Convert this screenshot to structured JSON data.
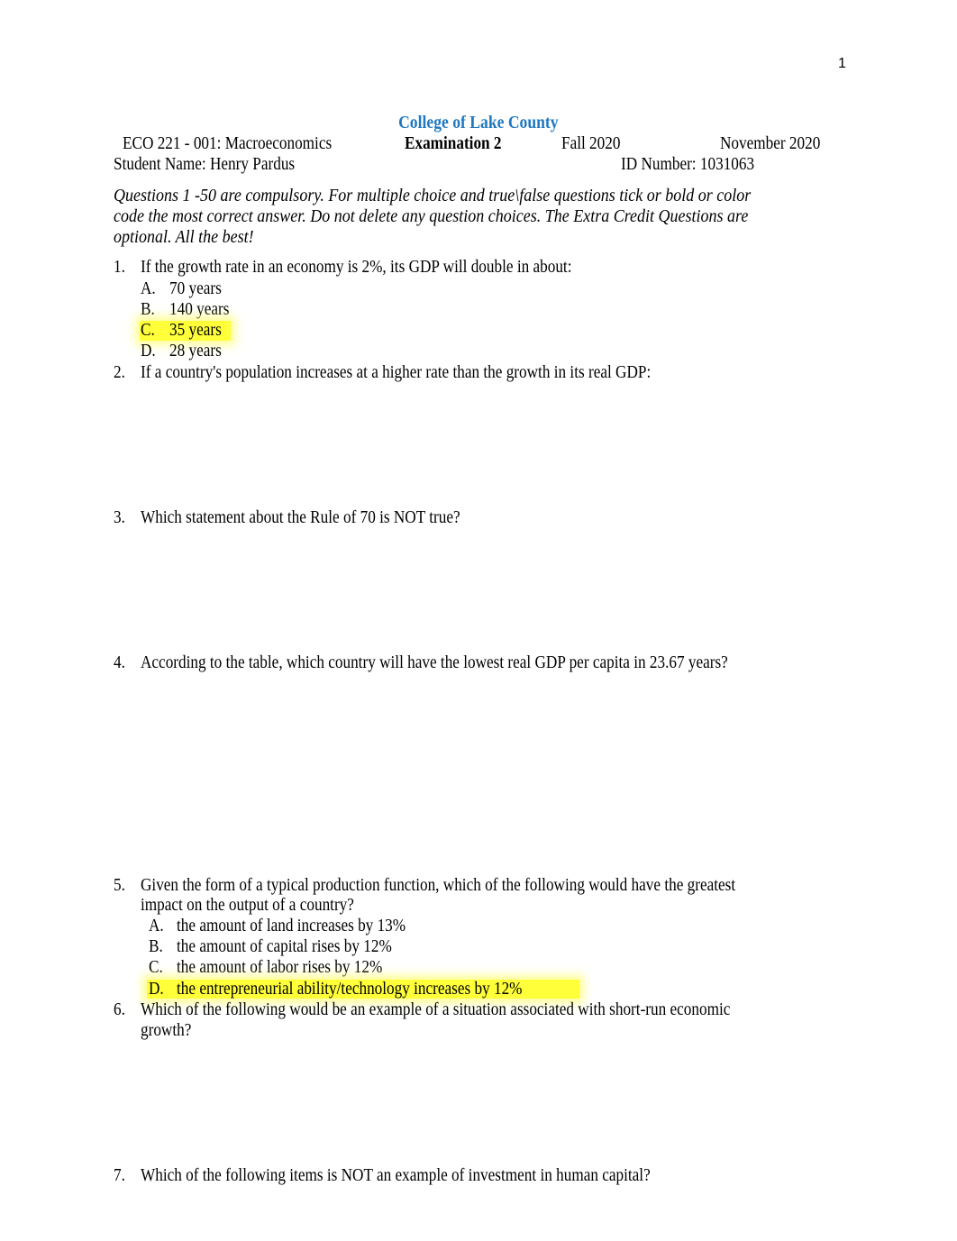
{
  "page_number": "1",
  "header": {
    "institution": "College of Lake County",
    "course": "ECO 221 - 001: Macroeconomics",
    "exam": "Examination 2",
    "term": "Fall 2020",
    "date": "November 2020",
    "student_name": "Student Name: Henry Pardus",
    "id_number": "ID Number: 1031063"
  },
  "instructions": [
    "Questions 1 -50 are compulsory. For multiple choice and true\\false questions tick or bold or color",
    "code the most correct answer. Do not delete any question choices. The Extra Credit Questions are",
    "optional. All the best!"
  ],
  "highlight_color": "#ffff00",
  "title_color": "#1f78c1",
  "questions": [
    {
      "number": "1.",
      "text": [
        "If the growth rate in an economy is 2%, its GDP will double in about:"
      ],
      "choices": [
        {
          "letter": "A.",
          "text": "70 years",
          "highlighted": false
        },
        {
          "letter": "B.",
          "text": "140 years",
          "highlighted": false
        },
        {
          "letter": "C.",
          "text": "35 years",
          "highlighted": true
        },
        {
          "letter": "D.",
          "text": "28 years",
          "highlighted": false
        }
      ]
    },
    {
      "number": "2.",
      "text": [
        "If a country's population increases at a higher rate than the growth in its real GDP:"
      ],
      "choices": []
    },
    {
      "number": "3.",
      "text": [
        "Which statement about the Rule of 70 is NOT true?"
      ],
      "choices": []
    },
    {
      "number": "4.",
      "text": [
        "According to the table, which country will have the lowest real GDP per capita in 23.67 years?"
      ],
      "choices": []
    },
    {
      "number": "5.",
      "text": [
        "Given the form of a typical production function, which of the following would have the greatest",
        "impact on the output of a country?"
      ],
      "choices": [
        {
          "letter": "A.",
          "text": "the amount of land increases by 13%",
          "highlighted": false
        },
        {
          "letter": "B.",
          "text": "the amount of capital rises by 12%",
          "highlighted": false
        },
        {
          "letter": "C.",
          "text": "the amount of labor rises by 12%",
          "highlighted": false
        },
        {
          "letter": "D.",
          "text": "the entrepreneurial ability/technology increases by 12%",
          "highlighted": true
        }
      ]
    },
    {
      "number": "6.",
      "text": [
        "Which of the following would be an example of a situation associated with short-run economic",
        "growth?"
      ],
      "choices": []
    },
    {
      "number": "7.",
      "text": [
        "Which of the following items is NOT an example of investment in human capital?"
      ],
      "choices": []
    }
  ]
}
